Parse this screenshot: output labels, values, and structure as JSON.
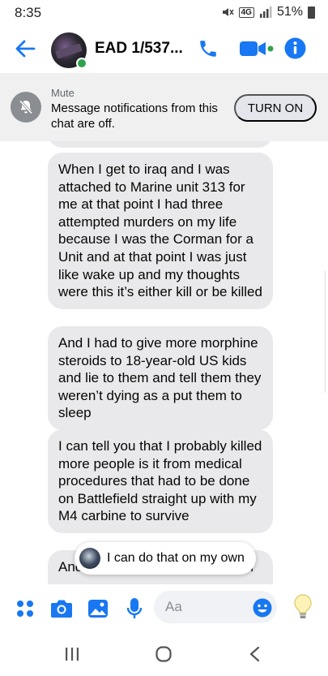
{
  "status_bar": {
    "time": "8:35",
    "network": "4G",
    "battery": "51%"
  },
  "header": {
    "contact_name": "EAD 1/537...",
    "accent_color": "#1877f2",
    "online_color": "#31a24c",
    "icons": [
      "back-arrow-icon",
      "phone-icon",
      "video-camera-icon",
      "info-icon"
    ]
  },
  "mute_banner": {
    "title": "Mute",
    "text": "Message notifications from this chat are off.",
    "button_label": "TURN ON"
  },
  "messages": [
    {
      "text": "When I get to iraq and I was attached to Marine unit 313 for me at that point I had three attempted murders on my life because I was the Corman for a Unit and at that point I was just like wake up and my thoughts were this it’s either kill or be killed"
    },
    {
      "text": "And I had to give more morphine steroids to 18-year-old US kids and lie to them and tell them they weren’t dying as a put them to sleep"
    },
    {
      "text": "I can tell you that I probably killed more people is it from medical procedures that had to be done on Battlefield straight up with my M4 carbine to survive"
    },
    {
      "text": "And I ... all the time we spend in"
    }
  ],
  "reply_suggestion": {
    "text": "I can do that on my own"
  },
  "composer": {
    "placeholder": "Aa",
    "icons": [
      "more-options-icon",
      "camera-icon",
      "gallery-icon",
      "microphone-icon",
      "emoji-icon",
      "lightbulb-icon"
    ]
  },
  "nav_bar": {
    "icons": [
      "recents-icon",
      "home-icon",
      "back-nav-icon"
    ]
  }
}
